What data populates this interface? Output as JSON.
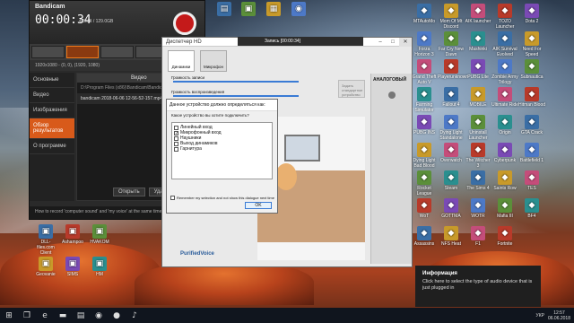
{
  "bandicam": {
    "title": "Bandicam",
    "timer": "00:00:34",
    "size": "4.5MB / 129.0GB",
    "resolution": "1920x1080 - (0, 0), (1920, 1080)",
    "sidebar": [
      "Основные",
      "Видео",
      "Изображения",
      "Обзор результатов",
      "О программе"
    ],
    "tab_video": "Видео",
    "path": "D:\\Program Files (x86)\\Bandicam\\Bandicam",
    "file": "bandicam 2018-06-06 12-56-52-157.mp4",
    "btn_open": "Открыть",
    "btn_delete": "Удалить",
    "status": "How to record 'computer sound' and 'my voice' at the same time?"
  },
  "device_window": {
    "title": "Диспетчер HD",
    "recbar": "Запись [00:00:34]",
    "tab_speakers": "Динамики",
    "tab_mic": "Микрофон",
    "vol_label": "Громкость записи",
    "play_label": "Громкость воспроизведения",
    "analog": "АНАЛОГОВЫЙ",
    "brand": "PurifiedVoice",
    "default_device": "Задать стандартное устройство"
  },
  "dialog": {
    "title": "Данное устройство должно определяться как:",
    "question": "Какое устройство вы хотите подключить?",
    "options": [
      {
        "label": "Линейный вход",
        "checked": false
      },
      {
        "label": "Микрофонный вход",
        "checked": true
      },
      {
        "label": "Наушники",
        "checked": false
      },
      {
        "label": "Выход динамиков",
        "checked": false
      },
      {
        "label": "Гарнитура",
        "checked": false
      }
    ],
    "remember": "Remember my selection and not show this dialogue next time",
    "ok": "OK"
  },
  "toast": {
    "title": "Информация",
    "body": "Click here to select the type of audio device that is just plugged in"
  },
  "desktop_left": [
    "DLL-files.com Client",
    "Ashampoo",
    "HVAKOM",
    "Geovanie",
    "SIMS",
    "HM"
  ],
  "desktop_right": [
    "MTAutoMo",
    "Mom Of Mt Discord",
    "AIK launcher",
    "TOZO Launcher",
    "Dota 2",
    "Forza Horizon 3",
    "Far Cry New Dawn",
    "Mashinki",
    "AIK Survival Evolved",
    "Need For Speed",
    "Grand Theft Auto V",
    "Playerunknown",
    "PUBG Lite",
    "Zombie Army Trilogy",
    "Subnautica",
    "Farming Simulator",
    "Fallout 4",
    "MOBILE",
    "Ultimate Ride",
    "Hitman Blood",
    "PUBG INS",
    "Dying Light Standalone",
    "Uninstall Launcher",
    "Origin",
    "GTA Crack",
    "Dying Light Bad Blood",
    "Overwatch",
    "The Witcher 3",
    "Cyberpunk",
    "Battlefield 1",
    "Rocket League",
    "Steam",
    "The Sims 4",
    "Saints Row",
    "TES",
    "WoT",
    "GOTTMA",
    "WOTR",
    "Mafia III",
    "BF4",
    "Assassins",
    "NFS Heat",
    "F1",
    "Fortnite"
  ],
  "tray": {
    "lang": "УКР",
    "time": "12:57",
    "date": "06.06.2018"
  }
}
